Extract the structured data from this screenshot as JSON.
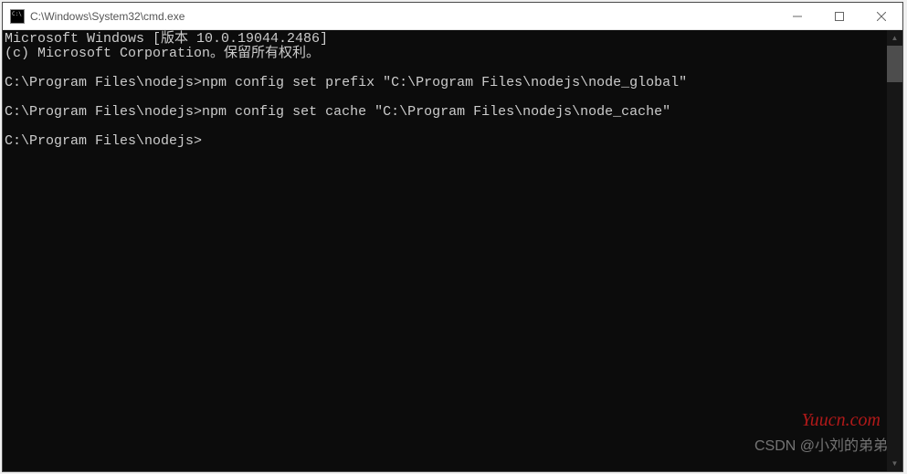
{
  "window": {
    "title": "C:\\Windows\\System32\\cmd.exe"
  },
  "terminal": {
    "banner_line1": "Microsoft Windows [版本 10.0.19044.2486]",
    "banner_line2": "(c) Microsoft Corporation。保留所有权利。",
    "prompt1": "C:\\Program Files\\nodejs>",
    "cmd1": "npm config set prefix \"C:\\Program Files\\nodejs\\node_global\"",
    "prompt2": "C:\\Program Files\\nodejs>",
    "cmd2": "npm config set cache \"C:\\Program Files\\nodejs\\node_cache\"",
    "prompt3": "C:\\Program Files\\nodejs>"
  },
  "watermarks": {
    "site": "Yuucn.com",
    "author": "CSDN @小刘的弟弟"
  }
}
